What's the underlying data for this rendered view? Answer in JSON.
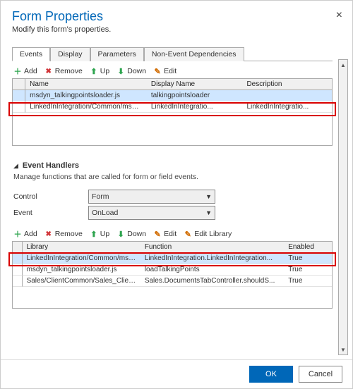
{
  "header": {
    "title": "Form Properties",
    "subtitle": "Modify this form's properties."
  },
  "tabs": [
    "Events",
    "Display",
    "Parameters",
    "Non-Event Dependencies"
  ],
  "toolbar1": {
    "add": "Add",
    "remove": "Remove",
    "up": "Up",
    "down": "Down",
    "edit": "Edit"
  },
  "libraries": {
    "columns": [
      "Name",
      "Display Name",
      "Description"
    ],
    "rows": [
      {
        "name": "msdyn_talkingpointsloader.js",
        "display": "talkingpointsloader",
        "desc": ""
      },
      {
        "name": "LinkedInIntegration/Common/msdyn_L...",
        "display": "LinkedInIntegratio...",
        "desc": "LinkedInIntegratio..."
      }
    ],
    "selected_index": 0,
    "highlight_index": 1
  },
  "event_handlers": {
    "section_title": "Event Handlers",
    "section_desc": "Manage functions that are called for form or field events.",
    "control_label": "Control",
    "event_label": "Event",
    "control_value": "Form",
    "event_value": "OnLoad"
  },
  "toolbar2": {
    "add": "Add",
    "remove": "Remove",
    "up": "Up",
    "down": "Down",
    "edit": "Edit",
    "edit_library": "Edit Library"
  },
  "handlers": {
    "columns": [
      "Library",
      "Function",
      "Enabled"
    ],
    "rows": [
      {
        "lib": "LinkedInIntegration/Common/msdyn_L...",
        "fn": "LinkedInIntegration.LinkedInIntegration...",
        "enabled": "True"
      },
      {
        "lib": "msdyn_talkingpointsloader.js",
        "fn": "loadTalkingPoints",
        "enabled": "True"
      },
      {
        "lib": "Sales/ClientCommon/Sales_ClientCom...",
        "fn": "Sales.DocumentsTabController.shouldS...",
        "enabled": "True"
      }
    ],
    "highlight_index": 0
  },
  "footer": {
    "ok": "OK",
    "cancel": "Cancel"
  }
}
